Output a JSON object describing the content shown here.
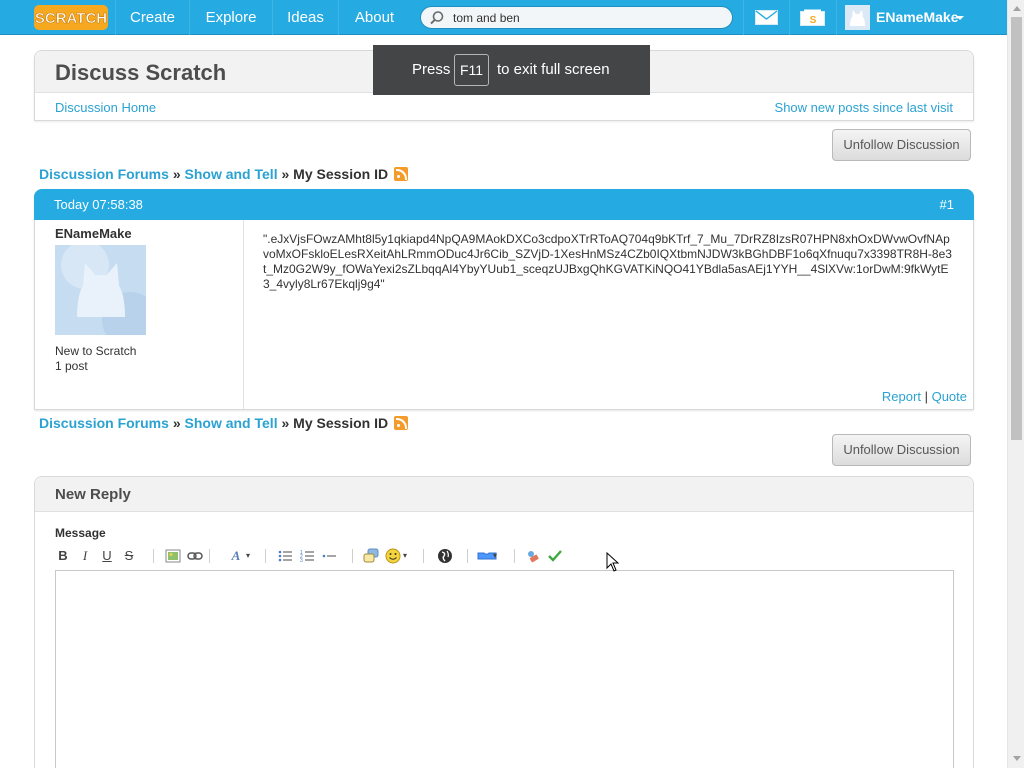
{
  "nav": {
    "logo_text": "SCRATCH",
    "links": [
      "Create",
      "Explore",
      "Ideas",
      "About"
    ],
    "search_value": "tom and ben",
    "username": "ENameMake"
  },
  "fullscreen_toast": {
    "press": "Press",
    "key": "F11",
    "rest": "to exit full screen"
  },
  "header": {
    "title": "Discuss Scratch",
    "home_link": "Discussion Home",
    "new_posts_link": "Show new posts since last visit"
  },
  "unfollow_label": "Unfollow Discussion",
  "breadcrumb": {
    "forums": "Discussion Forums",
    "sep": "»",
    "section": "Show and Tell",
    "topic": "My Session ID"
  },
  "post": {
    "date": "Today 07:58:38",
    "number": "#1",
    "author": "ENameMake",
    "rank": "New to Scratch",
    "post_count": "1 post",
    "body": "\".eJxVjsFOwzAMht8l5y1qkiapd4NpQA9MAokDXCo3cdpoXTrRToAQ704q9bKTrf_7_Mu_7DrRZ8IzsR07HPN8xhOxDWvwOvfNApvoMxOFskloELesRXeitAhLRmmODuc4Jr6Cib_SZVjD-1XesHnMSz4CZb0IQXtbmNJDW3kBGhDBF1o6qXfnuqu7x3398TR8H-8e3t_Mz0G2W9y_fOWaYexi2sZLbqqAl4YbyYUub1_sceqzUJBxgQhKGVATKiNQO41YBdla5asAEj1YYH__4SlXVw:1orDwM:9fkWytE3_4vyly8Lr67Ekqlj9g4\"",
    "report": "Report",
    "quote": "Quote",
    "action_sep": "|"
  },
  "reply": {
    "title": "New Reply",
    "message_label": "Message",
    "toolbar": {
      "bold": "B",
      "italic": "I",
      "underline": "U",
      "strike": "S",
      "font": "A"
    }
  }
}
